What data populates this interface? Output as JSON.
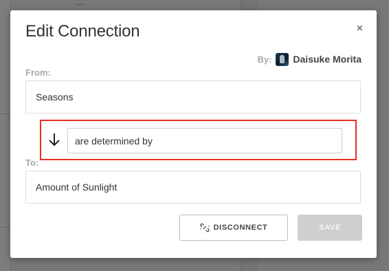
{
  "modal": {
    "title": "Edit Connection",
    "close_glyph": "×",
    "by_label": "By:",
    "author_name": "Daisuke Morita"
  },
  "from": {
    "label": "From:",
    "value": "Seasons"
  },
  "relationship": {
    "value": "are determined by",
    "arrow_icon": "arrow-down-icon",
    "highlight_color": "#e2321d"
  },
  "to": {
    "label": "To:",
    "value": "Amount of Sunlight"
  },
  "buttons": {
    "disconnect_label": "DISCONNECT",
    "disconnect_icon": "broken-link-icon",
    "save_label": "SAVE"
  }
}
